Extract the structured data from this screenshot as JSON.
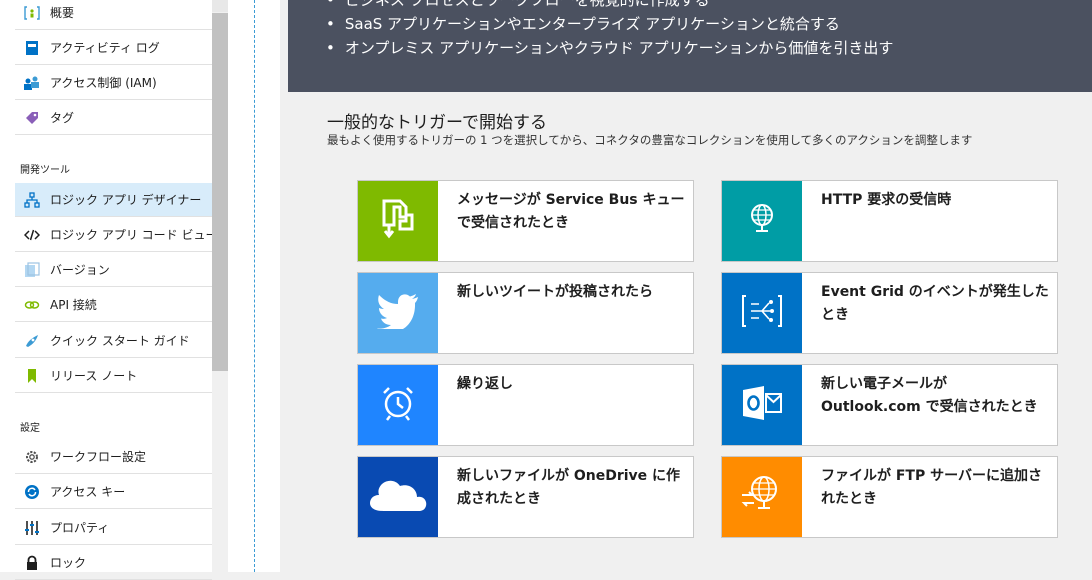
{
  "sidebar": {
    "items_top": [
      {
        "label": "概要",
        "icon": "overview-icon"
      },
      {
        "label": "アクティビティ ログ",
        "icon": "activity-log-icon"
      },
      {
        "label": "アクセス制御 (IAM)",
        "icon": "iam-icon"
      },
      {
        "label": "タグ",
        "icon": "tag-icon"
      }
    ],
    "section_dev": "開発ツール",
    "items_dev": [
      {
        "label": "ロジック アプリ デザイナー",
        "icon": "designer-icon"
      },
      {
        "label": "ロジック アプリ コード ビュー",
        "icon": "code-view-icon"
      },
      {
        "label": "バージョン",
        "icon": "versions-icon"
      },
      {
        "label": "API 接続",
        "icon": "api-connection-icon"
      },
      {
        "label": "クイック スタート ガイド",
        "icon": "quickstart-icon"
      },
      {
        "label": "リリース ノート",
        "icon": "release-notes-icon"
      }
    ],
    "section_settings": "設定",
    "items_settings": [
      {
        "label": "ワークフロー設定",
        "icon": "gear-icon"
      },
      {
        "label": "アクセス キー",
        "icon": "access-key-icon"
      },
      {
        "label": "プロパティ",
        "icon": "properties-icon"
      },
      {
        "label": "ロック",
        "icon": "lock-icon"
      }
    ]
  },
  "banner": {
    "bullets": [
      "ビジネス プロセスとワークフローを視覚的に作成する",
      "SaaS アプリケーションやエンタープライズ アプリケーションと統合する",
      "オンプレミス アプリケーションやクラウド アプリケーションから価値を引き出す"
    ]
  },
  "triggers": {
    "title": "一般的なトリガーで開始する",
    "subtitle": "最もよく使用するトリガーの 1 つを選択してから、コネクタの豊富なコレクションを使用して多くのアクションを調整します",
    "cards": [
      {
        "title": "メッセージが Service Bus キューで受信されたとき",
        "color": "#7fba00",
        "icon": "service-bus-icon"
      },
      {
        "title": "HTTP 要求の受信時",
        "color": "#009da5",
        "icon": "http-request-icon"
      },
      {
        "title": "新しいツイートが投稿されたら",
        "color": "#55acee",
        "icon": "twitter-icon"
      },
      {
        "title": "Event Grid のイベントが発生したとき",
        "color": "#0072c6",
        "icon": "event-grid-icon"
      },
      {
        "title": "繰り返し",
        "color": "#1f85ff",
        "icon": "recurrence-icon"
      },
      {
        "title": "新しい電子メールが Outlook.com で受信されたとき",
        "color": "#0072c6",
        "icon": "outlook-icon"
      },
      {
        "title": "新しいファイルが OneDrive に作成されたとき",
        "color": "#094ab2",
        "icon": "onedrive-icon"
      },
      {
        "title": "ファイルが FTP サーバーに追加されたとき",
        "color": "#ff8c00",
        "icon": "ftp-icon"
      }
    ]
  }
}
